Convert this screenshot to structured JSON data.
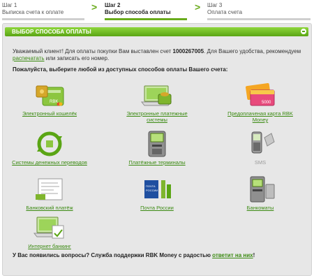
{
  "steps": [
    {
      "num": "Шаг 1",
      "title": "Выписка счета к оплате"
    },
    {
      "num": "Шаг 2",
      "title": "Выбор способа оплаты"
    },
    {
      "num": "Шаг 3",
      "title": "Оплата счета"
    }
  ],
  "colors": {
    "accent": "#6aab1c",
    "link": "#3b8a12",
    "header_from": "#8ed63c",
    "header_to": "#5aa514"
  },
  "panel": {
    "title": "ВЫБОР СПОСОБА ОПЛАТЫ",
    "intro_1": "Уважаемый клиент! Для оплаты покупки Вам выставлен счет ",
    "invoice_number": "1000267005",
    "intro_2": ". Для Вашего удобства, рекомендуем",
    "print_link": "распечатать",
    "intro_3": " или записать его номер.",
    "choose": "Пожалуйста, выберите любой из доступных способов оплаты Вашего счета:"
  },
  "methods": [
    {
      "label": "Электронный кошелёк",
      "icon": "wallet-icon"
    },
    {
      "label": "Электронные платежные системы",
      "icon": "laptop-wallet-icon"
    },
    {
      "label": "Предоплаченая карта RBK Money",
      "icon": "prepaid-card-icon",
      "card_value": "5000"
    },
    {
      "label": "Системы денежных переводов",
      "icon": "money-transfer-icon"
    },
    {
      "label": "Платёжные терминалы",
      "icon": "payment-terminal-icon"
    },
    {
      "label": "SMS",
      "icon": "mobile-phone-icon"
    },
    {
      "label": "Банковский платёж",
      "icon": "bank-payment-icon"
    },
    {
      "label": "Почта России",
      "icon": "russian-post-icon",
      "logo_text": "ПОЧТА РОССИИ"
    },
    {
      "label": "Банкоматы",
      "icon": "atm-icon"
    },
    {
      "label": "Интернет банкинг",
      "icon": "internet-banking-icon"
    }
  ],
  "footer": {
    "text": "У Вас появились вопросы? Служба поддержки RBK Money с радостью ",
    "link": "ответит на них",
    "end": "!"
  }
}
